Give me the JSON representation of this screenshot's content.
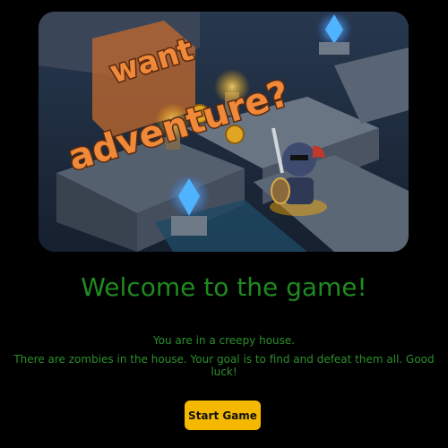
{
  "hero": {
    "art_text_line1": "want",
    "art_text_line2": "adventure?",
    "image_name": "adventure-banner"
  },
  "welcome": {
    "title": "Welcome to the game!",
    "line1": "You are in a creepy house.",
    "line2": "There are zombies in the house. Your goal is to find and defeat them all. Good luck!"
  },
  "actions": {
    "start_label": "Start Game"
  },
  "colors": {
    "background": "#000000",
    "title": "#1f8a1f",
    "text": "#2c8f2c",
    "button": "#f5b800"
  }
}
